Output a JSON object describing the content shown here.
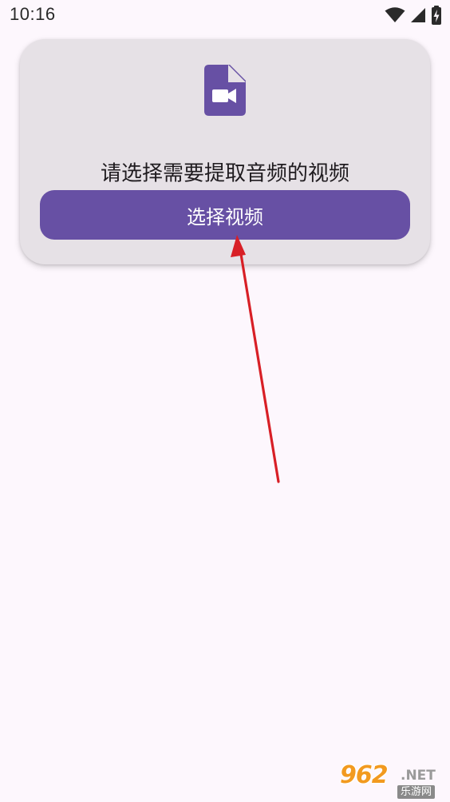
{
  "status_bar": {
    "time": "10:16",
    "icons": [
      "wifi-icon",
      "cellular-signal-icon",
      "battery-charging-icon"
    ]
  },
  "card": {
    "icon": "video-file-icon",
    "prompt": "请选择需要提取音频的视频",
    "button_label": "选择视频"
  },
  "annotation": {
    "type": "red-arrow",
    "points_to": "select-video-button",
    "color": "#d81f26"
  },
  "watermark": {
    "logo_number": "962",
    "logo_suffix": ".NET",
    "logo_subtitle": "乐游网"
  },
  "colors": {
    "background": "#fdf7fd",
    "card": "#e6e1e6",
    "accent": "#6750a4",
    "icon": "#6750a4",
    "arrow": "#d81f26"
  }
}
